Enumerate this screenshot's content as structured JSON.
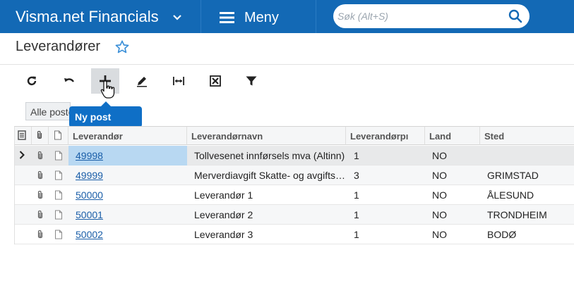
{
  "app": {
    "brand": "Visma.net Financials",
    "menu_label": "Meny",
    "search_placeholder": "Søk (Alt+S)"
  },
  "page": {
    "title": "Leverandører"
  },
  "toolbar": {
    "buttons": [
      {
        "name": "refresh-button",
        "icon": "refresh-icon"
      },
      {
        "name": "undo-button",
        "icon": "undo-icon"
      },
      {
        "name": "add-button",
        "icon": "plus-icon"
      },
      {
        "name": "edit-button",
        "icon": "pencil-icon"
      },
      {
        "name": "fit-columns-button",
        "icon": "fit-width-icon"
      },
      {
        "name": "export-excel-button",
        "icon": "excel-icon"
      },
      {
        "name": "filter-button",
        "icon": "filter-icon"
      }
    ],
    "tooltip": "Ny post"
  },
  "filter_tab": {
    "label": "Alle poster"
  },
  "grid": {
    "columns": [
      "Leverandør",
      "Leverandørnavn",
      "Leverandørpı",
      "Land",
      "Sted"
    ],
    "rows": [
      {
        "id": "49998",
        "name": "Tollvesenet innførsels mva (Altinn)",
        "pr": "1",
        "land": "NO",
        "sted": ""
      },
      {
        "id": "49999",
        "name": "Merverdiavgift Skatte- og avgiftsetaten",
        "pr": "3",
        "land": "NO",
        "sted": "GRIMSTAD"
      },
      {
        "id": "50000",
        "name": "Leverandør 1",
        "pr": "1",
        "land": "NO",
        "sted": "ÅLESUND"
      },
      {
        "id": "50001",
        "name": "Leverandør 2",
        "pr": "1",
        "land": "NO",
        "sted": "TRONDHEIM"
      },
      {
        "id": "50002",
        "name": "Leverandør 3",
        "pr": "1",
        "land": "NO",
        "sted": "BODØ"
      }
    ]
  },
  "colors": {
    "topbar": "#1369b5",
    "accent": "#0f6fc6",
    "link": "#1a5ea8",
    "selected_cell": "#b8d8f2"
  }
}
